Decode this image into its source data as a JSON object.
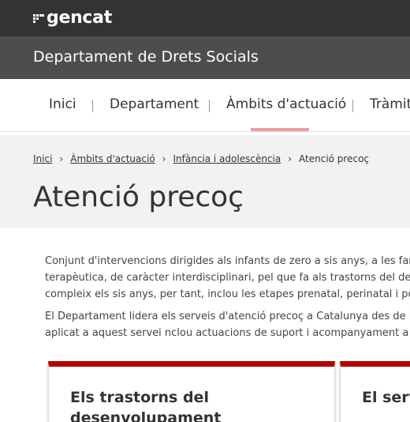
{
  "header": {
    "logo_text": "gencat",
    "department": "Departament de Drets Socials"
  },
  "nav": {
    "items": [
      {
        "label": "Inici"
      },
      {
        "label": "Departament"
      },
      {
        "label": "Àmbits d'actuació",
        "active": true
      },
      {
        "label": "Tràmit"
      }
    ]
  },
  "breadcrumb": {
    "items": [
      "Inici",
      "Àmbits d'actuació",
      "Infància i adolescència",
      "Atenció precoç"
    ]
  },
  "page": {
    "title": "Atenció precoç",
    "paragraphs": [
      [
        "Conjunt d'intervencions dirigides als infants de zero a sis anys, a les fam",
        "terapèutica, de caràcter interdisciplinari, pel que fa als trastorns del des",
        "compleix els sis anys, per tant, inclou les etapes prenatal, perinatal i pos"
      ],
      [
        "El Departament lidera els serveis d'atenció precoç a Catalunya des de l'a",
        "aplicat a aquest servei nclou actuacions de suport i acompanyament a l"
      ]
    ]
  },
  "cards": [
    {
      "title_line1": "Els trastorns del",
      "title_line2": "desenvolupament"
    },
    {
      "title_line1": "El serv",
      "title_line2": ""
    }
  ],
  "colors": {
    "topbar": "#333333",
    "deptbar": "#4d4d4d",
    "accent": "#b30000",
    "nav_underline": "#f29b9b"
  }
}
